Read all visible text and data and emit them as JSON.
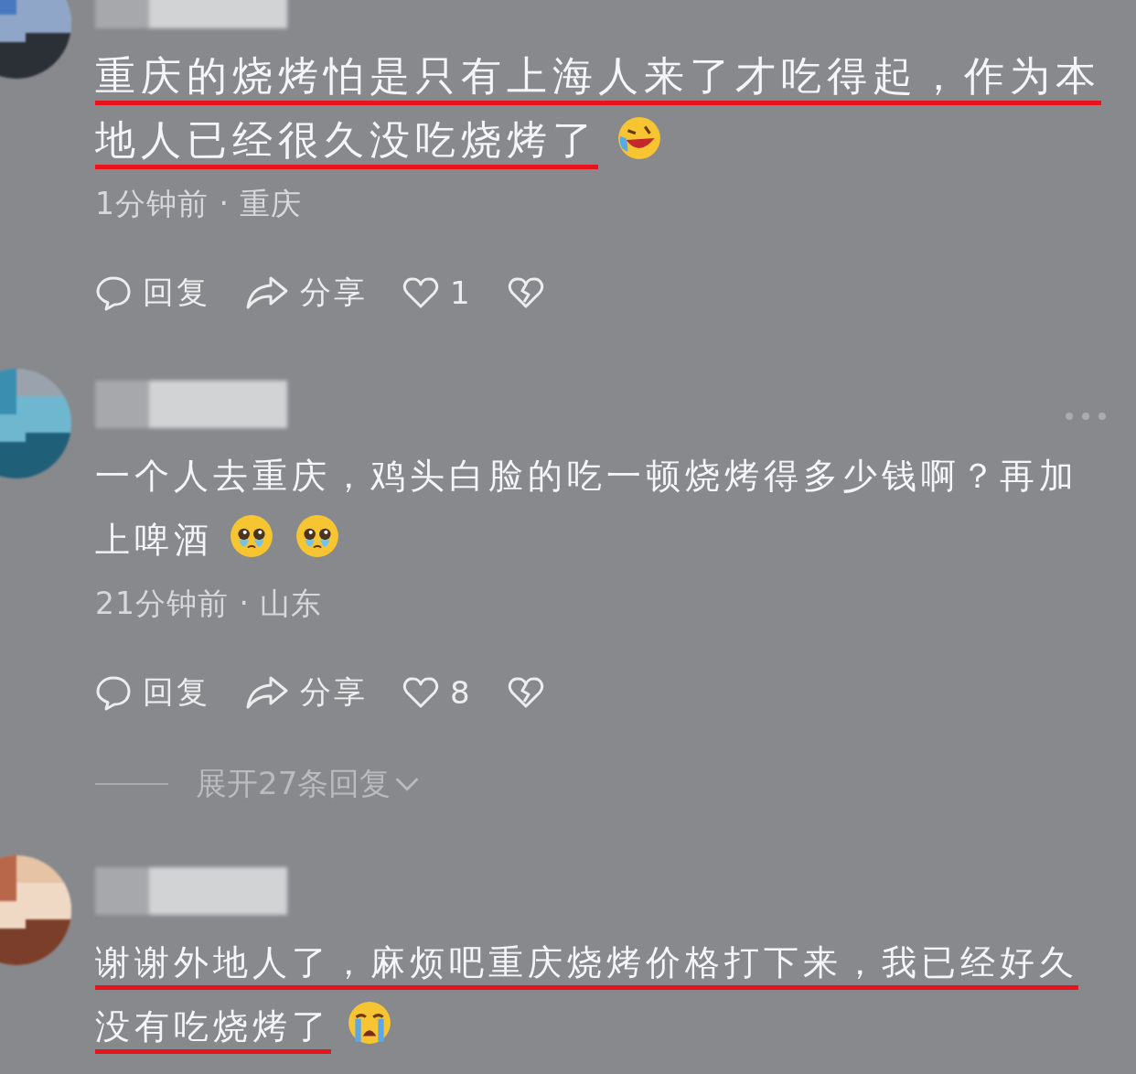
{
  "comments": [
    {
      "text": "重庆的烧烤怕是只有上海人来了才吃得起，作为本地人已经很久没吃烧烤了",
      "underlined": true,
      "emojis": [
        {
          "kind": "laughing"
        }
      ],
      "meta": "1分钟前 · 重庆",
      "actions": {
        "reply": "回复",
        "share": "分享",
        "likes": "1"
      }
    },
    {
      "text": "一个人去重庆，鸡头白脸的吃一顿烧烤得多少钱啊？再加上啤酒",
      "underlined": false,
      "emojis": [
        {
          "kind": "teary"
        },
        {
          "kind": "teary"
        }
      ],
      "meta": "21分钟前 · 山东",
      "actions": {
        "reply": "回复",
        "share": "分享",
        "likes": "8"
      },
      "more_menu": true,
      "expand": "展开27条回复"
    },
    {
      "text": "谢谢外地人了，麻烦吧重庆烧烤价格打下来，我已经好久没有吃烧烤了",
      "underlined": true,
      "emojis": [
        {
          "kind": "crying"
        }
      ]
    }
  ]
}
